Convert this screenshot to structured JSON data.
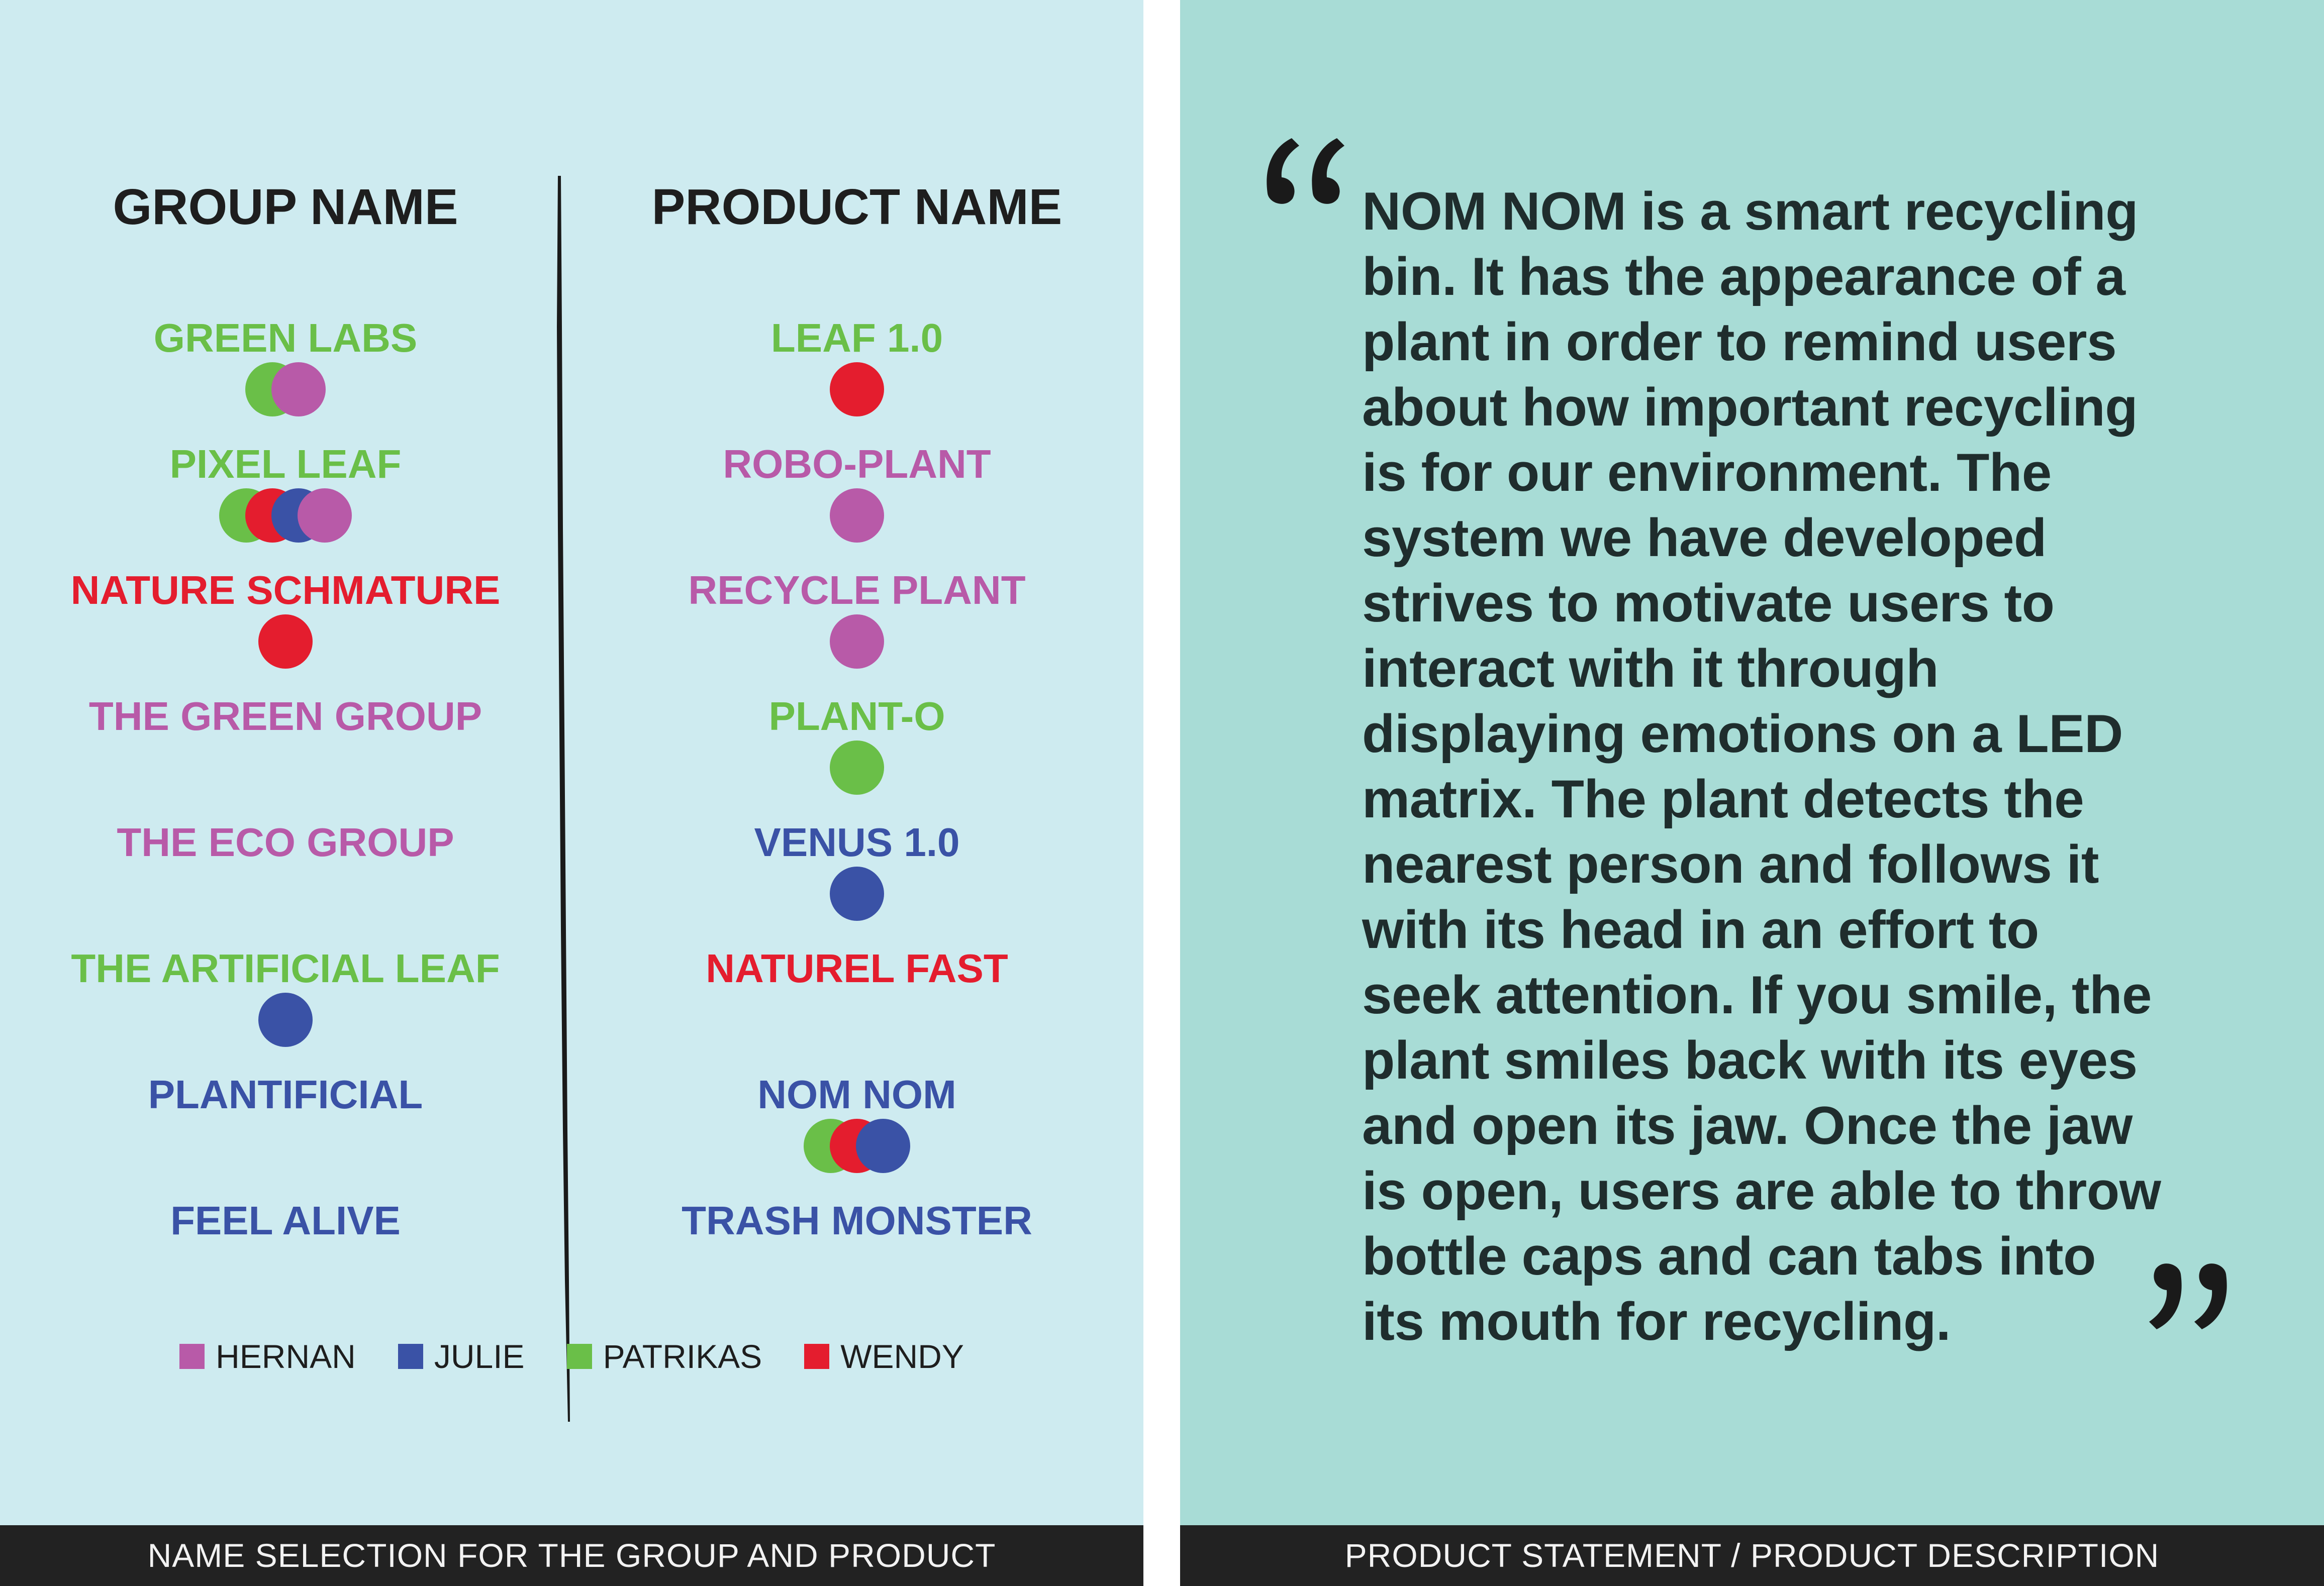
{
  "colors": {
    "hernan": "#b85aa8",
    "julie": "#3a52a6",
    "patrikas": "#6abf48",
    "wendy": "#e41d2e",
    "left_background": "#ceebf0",
    "right_background": "#a8dcd6",
    "footer_background": "#222222"
  },
  "left": {
    "group_heading": "GROUP NAME",
    "product_heading": "PRODUCT NAME",
    "groups": [
      {
        "label": "GREEN LABS",
        "color": "patrikas",
        "votes": [
          "patrikas",
          "hernan"
        ]
      },
      {
        "label": "PIXEL LEAF",
        "color": "patrikas",
        "votes": [
          "patrikas",
          "wendy",
          "julie",
          "hernan"
        ]
      },
      {
        "label": "NATURE SCHMATURE",
        "color": "wendy",
        "votes": [
          "wendy"
        ]
      },
      {
        "label": "THE GREEN GROUP",
        "color": "hernan",
        "votes": []
      },
      {
        "label": "THE ECO GROUP",
        "color": "hernan",
        "votes": []
      },
      {
        "label": "THE ARTIFICIAL LEAF",
        "color": "patrikas",
        "votes": [
          "julie"
        ]
      },
      {
        "label": "PLANTIFICIAL",
        "color": "julie",
        "votes": []
      },
      {
        "label": "FEEL ALIVE",
        "color": "julie",
        "votes": []
      }
    ],
    "products": [
      {
        "label": "LEAF 1.0",
        "color": "patrikas",
        "votes": [
          "wendy"
        ]
      },
      {
        "label": "ROBO-PLANT",
        "color": "hernan",
        "votes": [
          "hernan"
        ]
      },
      {
        "label": "RECYCLE PLANT",
        "color": "hernan",
        "votes": [
          "hernan"
        ]
      },
      {
        "label": "PLANT-O",
        "color": "patrikas",
        "votes": [
          "patrikas"
        ]
      },
      {
        "label": "VENUS 1.0",
        "color": "julie",
        "votes": [
          "julie"
        ]
      },
      {
        "label": "NATUREL FAST",
        "color": "wendy",
        "votes": []
      },
      {
        "label": "NOM NOM",
        "color": "julie",
        "votes": [
          "patrikas",
          "wendy",
          "julie"
        ]
      },
      {
        "label": "TRASH MONSTER",
        "color": "julie",
        "votes": []
      }
    ],
    "legend": [
      {
        "key": "hernan",
        "label": "HERNAN"
      },
      {
        "key": "julie",
        "label": "JULIE"
      },
      {
        "key": "patrikas",
        "label": "PATRIKAS"
      },
      {
        "key": "wendy",
        "label": "WENDY"
      }
    ],
    "footer": "NAME SELECTION FOR THE GROUP AND PRODUCT"
  },
  "right": {
    "statement_lines": [
      "NOM NOM is a smart recycling",
      "bin. It has the appearance of a",
      "plant in order to remind users",
      "about how important recycling",
      "is for our environment. The",
      "system we have developed",
      "strives to motivate users to",
      "interact with it through",
      "displaying emotions on a LED",
      "matrix. The plant detects the",
      "nearest person and follows it",
      "with its head in an effort to",
      "seek attention. If you smile, the",
      "plant smiles back with its eyes",
      "and open its jaw. Once the jaw",
      "is open, users are able to throw",
      "bottle caps and can tabs into",
      "its mouth for recycling."
    ],
    "footer": "PRODUCT STATEMENT / PRODUCT DESCRIPTION"
  }
}
